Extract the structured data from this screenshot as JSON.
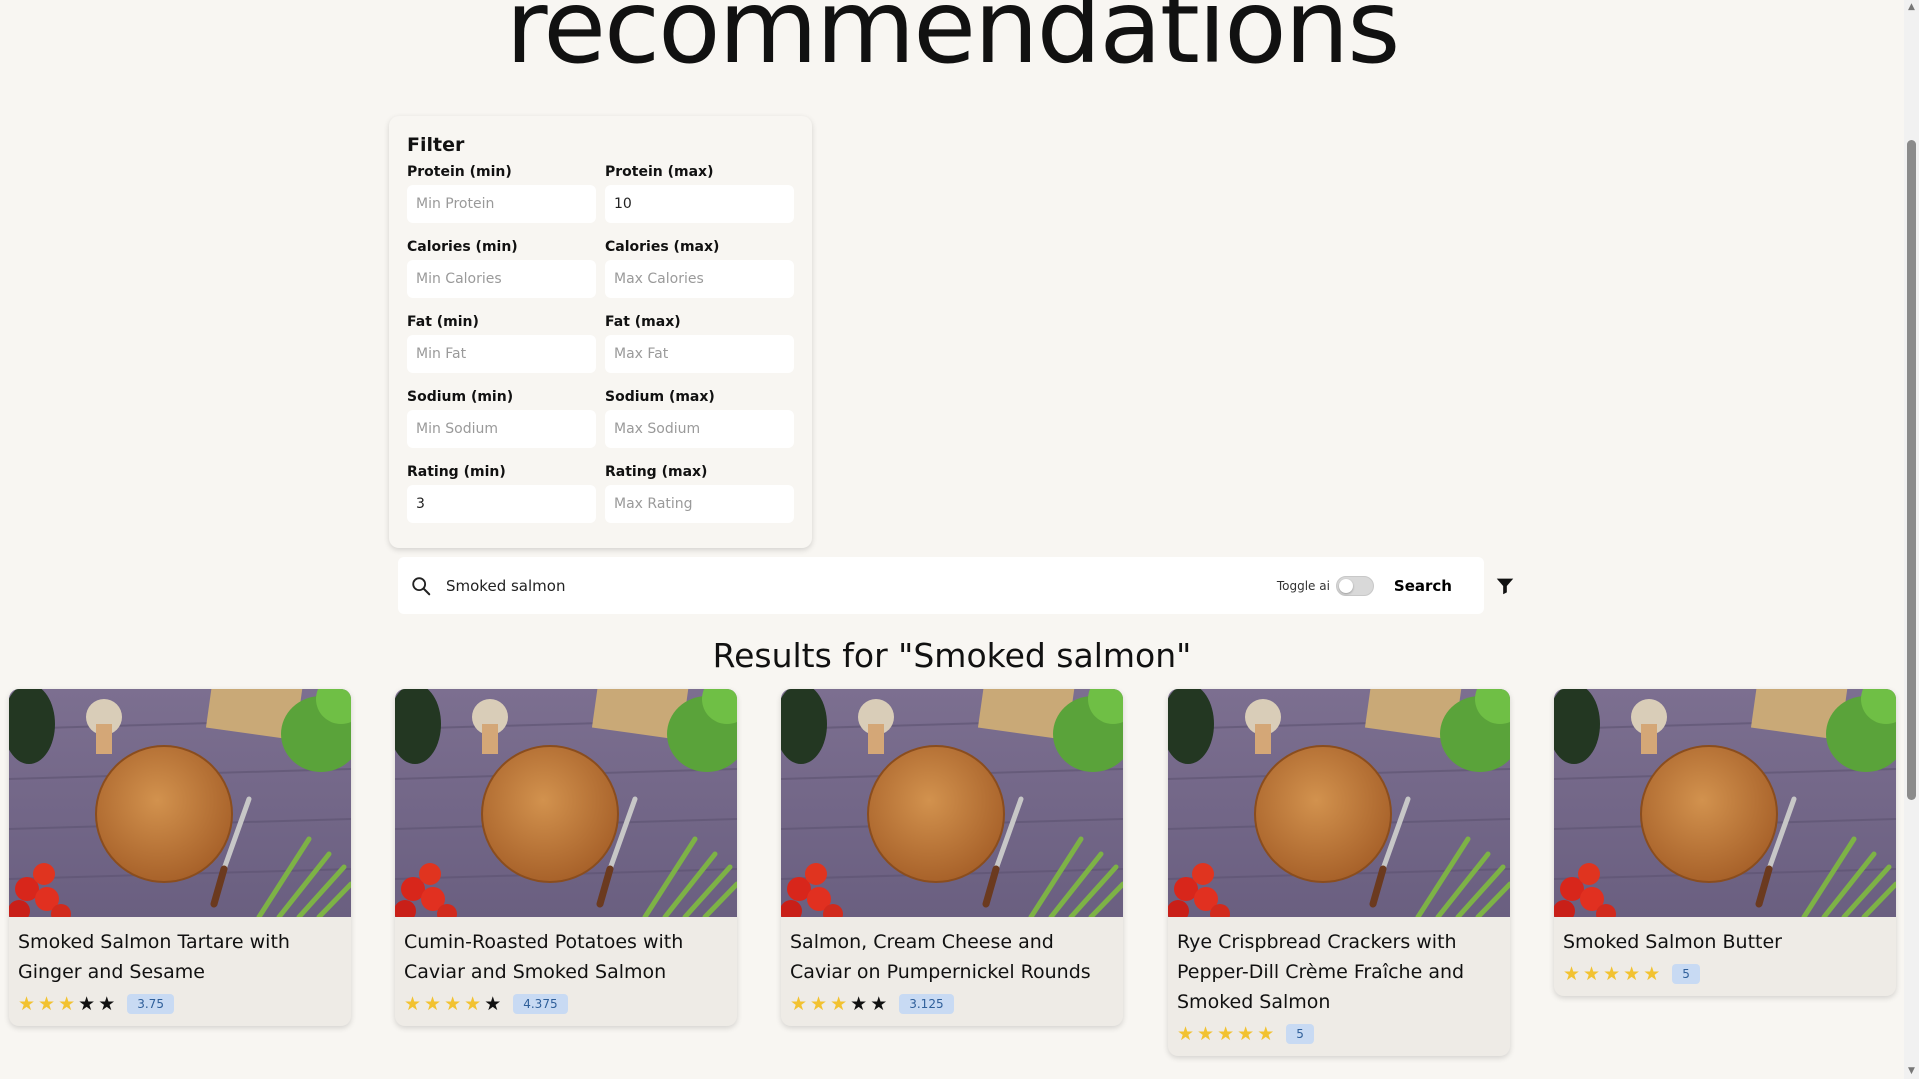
{
  "page": {
    "title": "recommendations"
  },
  "filter": {
    "heading": "Filter",
    "fields": [
      {
        "label": "Protein (min)",
        "placeholder": "Min Protein",
        "value": ""
      },
      {
        "label": "Protein (max)",
        "placeholder": "Max Protein",
        "value": "10"
      },
      {
        "label": "Calories (min)",
        "placeholder": "Min Calories",
        "value": ""
      },
      {
        "label": "Calories (max)",
        "placeholder": "Max Calories",
        "value": ""
      },
      {
        "label": "Fat (min)",
        "placeholder": "Min Fat",
        "value": ""
      },
      {
        "label": "Fat (max)",
        "placeholder": "Max Fat",
        "value": ""
      },
      {
        "label": "Sodium (min)",
        "placeholder": "Min Sodium",
        "value": ""
      },
      {
        "label": "Sodium (max)",
        "placeholder": "Max Sodium",
        "value": ""
      },
      {
        "label": "Rating (min)",
        "placeholder": "Min Rating",
        "value": "3"
      },
      {
        "label": "Rating (max)",
        "placeholder": "Max Rating",
        "value": ""
      }
    ]
  },
  "search": {
    "value": "Smoked salmon",
    "toggle_label": "Toggle ai",
    "toggle_on": false,
    "button_label": "Search"
  },
  "results": {
    "title": "Results for \"Smoked salmon\"",
    "items": [
      {
        "title": "Smoked Salmon Tartare with Ginger and Sesame",
        "stars_filled": 3,
        "rating": "3.75"
      },
      {
        "title": "Cumin-Roasted Potatoes with Caviar and Smoked Salmon",
        "stars_filled": 4,
        "rating": "4.375"
      },
      {
        "title": "Salmon, Cream Cheese and Caviar on Pumpernickel Rounds",
        "stars_filled": 3,
        "rating": "3.125"
      },
      {
        "title": "Rye Crispbread Crackers with Pepper-Dill Crème Fraîche and Smoked Salmon",
        "stars_filled": 5,
        "rating": "5"
      },
      {
        "title": "Smoked Salmon Butter",
        "stars_filled": 5,
        "rating": "5"
      }
    ]
  },
  "colors": {
    "star_filled": "#f2c230",
    "star_empty": "#111111",
    "badge_bg": "#c8daf3"
  }
}
